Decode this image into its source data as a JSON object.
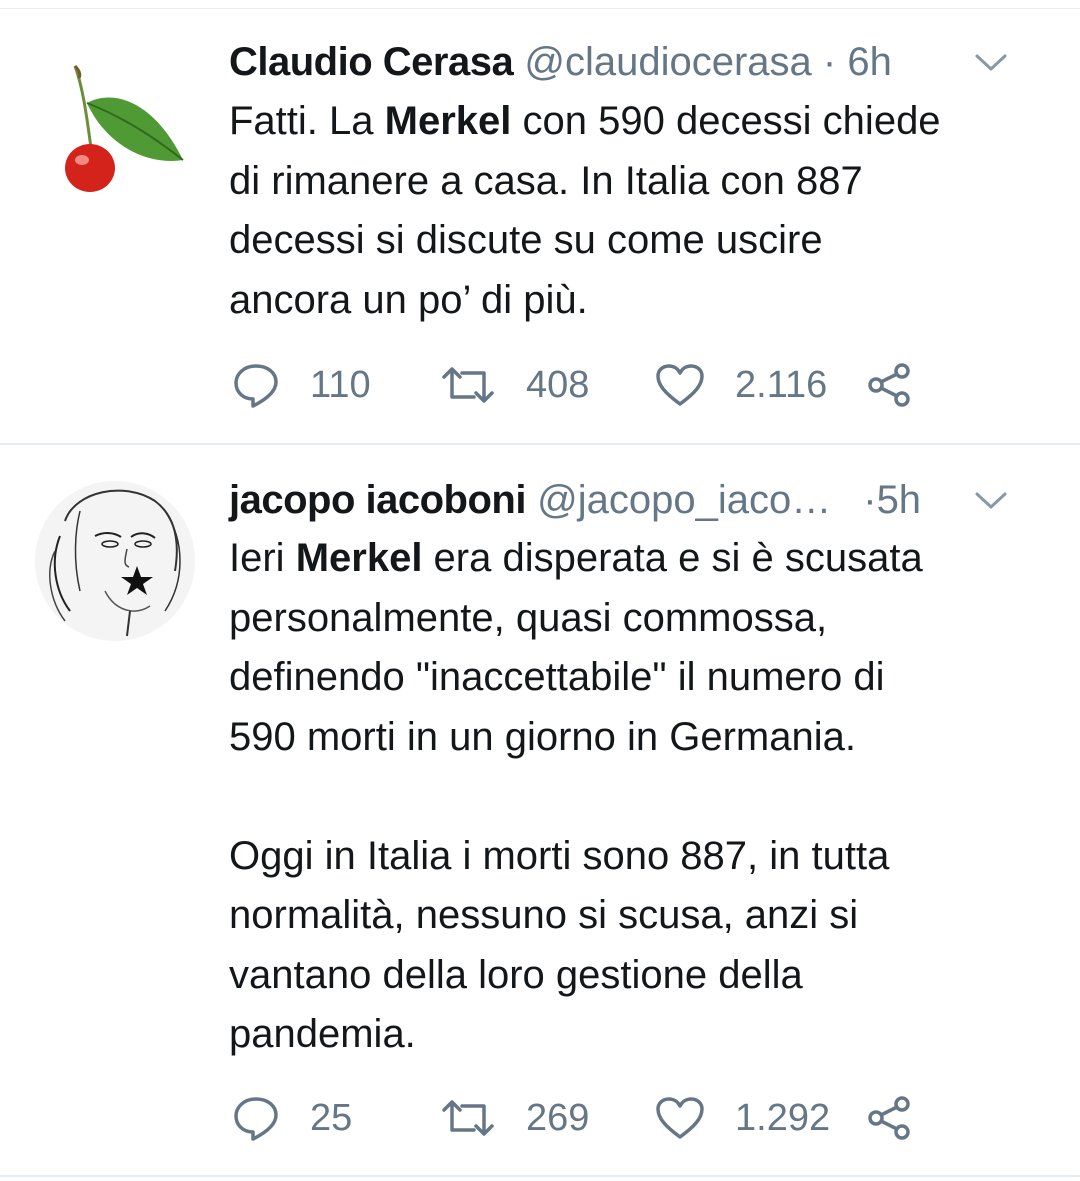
{
  "tweets": [
    {
      "author_name": "Claudio Cerasa",
      "handle": "@claudiocerasa",
      "separator": "·",
      "time": "6h",
      "avatar_icon": "cherry-avatar",
      "body": {
        "l1a": "Fatti. La ",
        "l1b": "Merkel",
        "l1c": " con 590 decessi chiede",
        "l2": "di rimanere a casa. In Italia con 887",
        "l3": "decessi si discute su come uscire",
        "l4": "ancora un po’ di più."
      },
      "stats": {
        "replies": "110",
        "retweets": "408",
        "likes": "2.116"
      }
    },
    {
      "author_name": "jacopo iacoboni",
      "handle": "@jacopo_iacoboni",
      "separator": "·",
      "time": "5h",
      "avatar_icon": "sketch-portrait-avatar",
      "body": {
        "l1a": "Ieri ",
        "l1b": "Merkel",
        "l1c": " era disperata e si è scusata",
        "l2": "personalmente, quasi commossa,",
        "l3": "definendo \"inaccettabile\" il numero di",
        "l4": "590 morti in un giorno in Germania.",
        "l5": "Oggi in Italia i morti sono 887, in tutta",
        "l6": "normalità, nessuno si scusa, anzi si",
        "l7": "vantano della loro gestione della",
        "l8": "pandemia."
      },
      "stats": {
        "replies": "25",
        "retweets": "269",
        "likes": "1.292"
      }
    }
  ],
  "colors": {
    "text_primary": "#14171a",
    "text_secondary": "#657786",
    "divider": "#e6ecf0"
  }
}
